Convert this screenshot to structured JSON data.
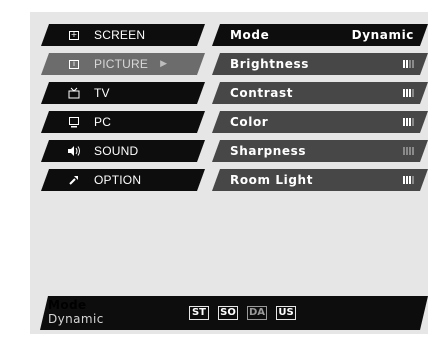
{
  "menu": {
    "items": [
      {
        "label": "SCREEN",
        "icon": "screen-icon"
      },
      {
        "label": "PICTURE",
        "icon": "picture-icon",
        "selected": true
      },
      {
        "label": "TV",
        "icon": "tv-icon"
      },
      {
        "label": "PC",
        "icon": "pc-icon"
      },
      {
        "label": "SOUND",
        "icon": "sound-icon"
      },
      {
        "label": "OPTION",
        "icon": "option-icon"
      }
    ],
    "arrow": "▶"
  },
  "settings": {
    "header": {
      "label": "Mode",
      "value": "Dynamic"
    },
    "rows": [
      {
        "label": "Brightness",
        "level": 0.5
      },
      {
        "label": "Contrast",
        "level": 0.75
      },
      {
        "label": "Color",
        "level": 0.75
      },
      {
        "label": "Sharpness",
        "level": 0.0
      },
      {
        "label": "Room Light",
        "level": 0.75
      }
    ]
  },
  "bottom": {
    "title": "Mode",
    "value": "Dynamic",
    "presets": [
      {
        "label": "ST",
        "active": true
      },
      {
        "label": "SO",
        "active": true
      },
      {
        "label": "DA",
        "active": false
      },
      {
        "label": "US",
        "active": true
      }
    ]
  },
  "colors": {
    "menu_bg": "#0d0d0d",
    "menu_selected_bg": "#6c6c6c",
    "row_bg": "#474747",
    "panel_bg": "#e6e6e6"
  }
}
